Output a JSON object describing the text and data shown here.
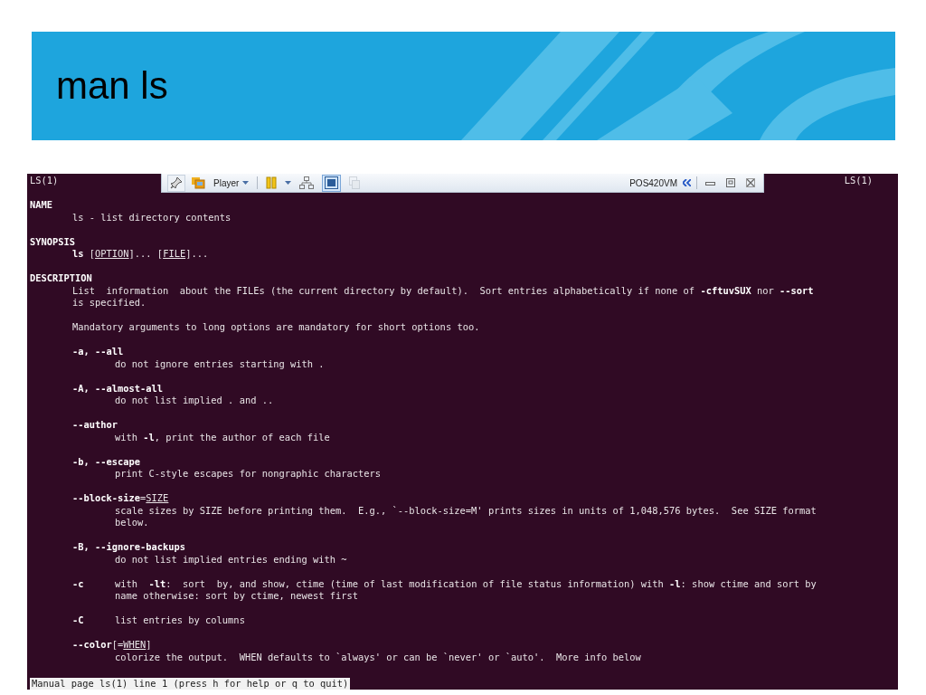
{
  "slide": {
    "title": "man ls"
  },
  "toolbar": {
    "menu_label": "Player",
    "vm_name": "POS420VM"
  },
  "terminal": {
    "header_left": "LS(1)",
    "header_right": "LS(1)",
    "lines": [
      {
        "kind": "blank"
      },
      {
        "kind": "heading",
        "text": "NAME"
      },
      {
        "kind": "body",
        "text": "ls - list directory contents"
      },
      {
        "kind": "blank"
      },
      {
        "kind": "heading",
        "text": "SYNOPSIS"
      },
      {
        "kind": "body",
        "text": "**ls** [*OPTION*]... [*FILE*]..."
      },
      {
        "kind": "blank"
      },
      {
        "kind": "heading",
        "text": "DESCRIPTION"
      },
      {
        "kind": "body",
        "text": "List  information  about the FILEs (the current directory by default).  Sort entries alphabetically if none of **-cftuvSUX** nor **--sort**"
      },
      {
        "kind": "body",
        "text": "is specified."
      },
      {
        "kind": "blank"
      },
      {
        "kind": "body",
        "text": "Mandatory arguments to long options are mandatory for short options too."
      },
      {
        "kind": "blank"
      },
      {
        "kind": "option",
        "text": "-a, --all"
      },
      {
        "kind": "desc",
        "text": "do not ignore entries starting with ."
      },
      {
        "kind": "blank"
      },
      {
        "kind": "option",
        "text": "-A, --almost-all"
      },
      {
        "kind": "desc",
        "text": "do not list implied . and .."
      },
      {
        "kind": "blank"
      },
      {
        "kind": "option",
        "text": "--author"
      },
      {
        "kind": "desc",
        "text": "with **-l**, print the author of each file"
      },
      {
        "kind": "blank"
      },
      {
        "kind": "option",
        "text": "-b, --escape"
      },
      {
        "kind": "desc",
        "text": "print C-style escapes for nongraphic characters"
      },
      {
        "kind": "blank"
      },
      {
        "kind": "option_parts",
        "text": "**--block-size**=*SIZE*"
      },
      {
        "kind": "desc",
        "text": "scale sizes by SIZE before printing them.  E.g., `--block-size=M' prints sizes in units of 1,048,576 bytes.  See SIZE format"
      },
      {
        "kind": "desc",
        "text": "below."
      },
      {
        "kind": "blank"
      },
      {
        "kind": "option",
        "text": "-B, --ignore-backups"
      },
      {
        "kind": "desc",
        "text": "do not list implied entries ending with ~"
      },
      {
        "kind": "blank"
      },
      {
        "kind": "option_row",
        "option": "-c",
        "text": "with  **-lt**:  sort  by, and show, ctime (time of last modification of file status information) with **-l**: show ctime and sort by"
      },
      {
        "kind": "desc",
        "text": "name otherwise: sort by ctime, newest first"
      },
      {
        "kind": "blank"
      },
      {
        "kind": "option_row",
        "option": "-C",
        "text": "list entries by columns"
      },
      {
        "kind": "blank"
      },
      {
        "kind": "option_parts",
        "text": "**--color**[=*WHEN*]"
      },
      {
        "kind": "desc",
        "text": "colorize the output.  WHEN defaults to `always' or can be `never' or `auto'.  More info below"
      },
      {
        "kind": "blank"
      }
    ],
    "status_line": "Manual page ls(1) line 1 (press h for help or q to quit)"
  }
}
